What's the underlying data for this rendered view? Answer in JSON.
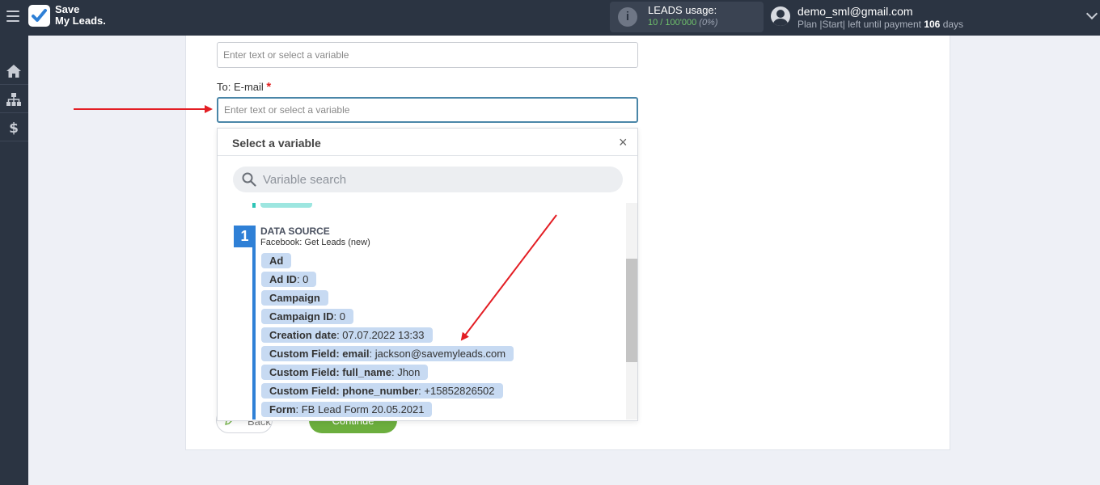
{
  "app": {
    "logo_line1": "Save",
    "logo_line2": "My Leads."
  },
  "header": {
    "usage_title": "LEADS usage:",
    "usage_value": "10 / 100'000",
    "usage_percent": "(0%)",
    "user_email": "demo_sml@gmail.com",
    "plan_text": "Plan |Start| left until payment",
    "plan_days": "106",
    "plan_days_unit": "days"
  },
  "sidebar": {
    "items": [
      {
        "icon": "home-icon"
      },
      {
        "icon": "sitemap-icon"
      },
      {
        "icon": "dollar-icon"
      }
    ]
  },
  "form": {
    "prev_input_placeholder": "Enter text or select a variable",
    "to_email_label": "To: E-mail",
    "required_mark": "*",
    "to_email_placeholder": "Enter text or select a variable",
    "back_label": "Back",
    "continue_label": "Continue"
  },
  "dropdown": {
    "title": "Select a variable",
    "close": "×",
    "search_placeholder": "Variable search",
    "source": {
      "number": "1",
      "title": "DATA SOURCE",
      "subtitle": "Facebook: Get Leads (new)"
    },
    "items": [
      {
        "key": "Ad",
        "value": ""
      },
      {
        "key": "Ad ID",
        "value": ": 0"
      },
      {
        "key": "Campaign",
        "value": ""
      },
      {
        "key": "Campaign ID",
        "value": ": 0"
      },
      {
        "key": "Creation date",
        "value": ": 07.07.2022 13:33"
      },
      {
        "key": "Custom Field: email",
        "value": ": jackson@savemyleads.com"
      },
      {
        "key": "Custom Field: full_name",
        "value": ": Jhon"
      },
      {
        "key": "Custom Field: phone_number",
        "value": ": +15852826502"
      },
      {
        "key": "Form",
        "value": ": FB Lead Form 20.05.2021"
      }
    ]
  },
  "colors": {
    "topbar": "#2b3442",
    "accent_blue": "#2f80d6",
    "chip": "#c7daf2",
    "continue_green": "#6cae3e",
    "arrow_red": "#e31e24"
  }
}
